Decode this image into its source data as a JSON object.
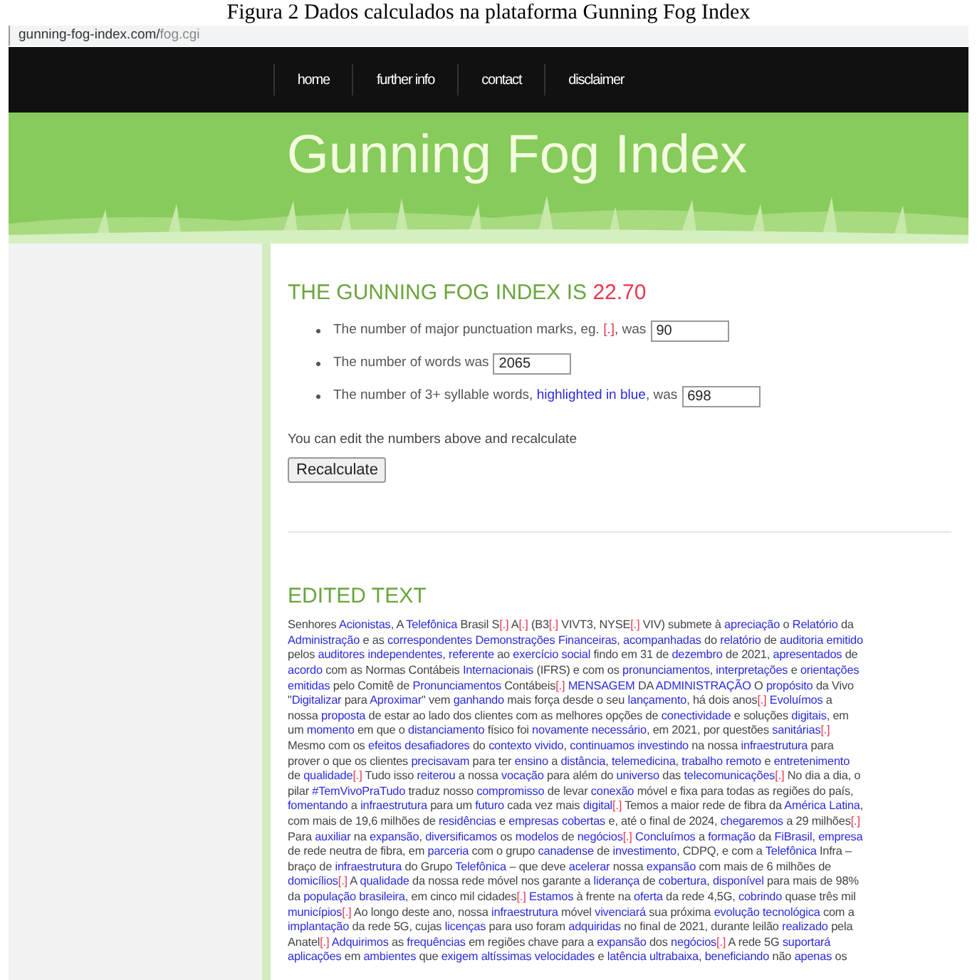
{
  "caption": "Figura 2 Dados calculados na plataforma Gunning Fog Index",
  "address_bar": {
    "host": "gunning-fog-index.com/",
    "path": "fog.cgi"
  },
  "nav": [
    {
      "label": "home"
    },
    {
      "label": "further info"
    },
    {
      "label": "contact"
    },
    {
      "label": "disclaimer"
    }
  ],
  "banner": {
    "title": "Gunning Fog Index"
  },
  "result": {
    "heading": "THE GUNNING FOG INDEX IS",
    "score": "22.70"
  },
  "measures": [
    {
      "text": "The number of major punctuation marks, eg. *[.]*, was",
      "value": "90"
    },
    {
      "text": "The number of words was",
      "value": "2065"
    },
    {
      "text": "The number of 3+ syllable words, **highlighted in blue**, was",
      "value": "698"
    }
  ],
  "note": "You can edit the numbers above and recalculate",
  "recalculate_button": "Recalculate",
  "edited_text": {
    "heading": "EDITED TEXT",
    "lines": [
      [
        {
          "kind": "text",
          "text": "Senhores **Acionistas**, A **Telefônica** Brasil S"
        },
        {
          "kind": "mark",
          "text": "[.]"
        },
        {
          "kind": "text",
          "text": " A"
        },
        {
          "kind": "mark",
          "text": "[.]"
        },
        {
          "kind": "text",
          "text": " (B3"
        },
        {
          "kind": "mark",
          "text": "[.]"
        },
        {
          "kind": "text",
          "text": " VIVT3, NYSE"
        },
        {
          "kind": "mark",
          "text": "[.]"
        },
        {
          "kind": "text",
          "text": " VIV) submete à **apreciação** o **Relatório** da"
        }
      ],
      [
        {
          "kind": "text",
          "text": "**Administração** e as **correspondentes** **Demonstrações** **Financeiras**, **acompanhadas** do **relatório** de **auditoria** **emitido**"
        }
      ],
      [
        {
          "kind": "text",
          "text": "pelos **auditores** **independentes**, **referente** ao **exercício** **social** findo em 31 de **dezembro** de 2021, **apresentados** de"
        }
      ],
      [
        {
          "kind": "text",
          "text": "**acordo** com as Normas Contábeis **Internacionais** (IFRS) e com os **pronunciamentos**, **interpretações** e **orientações**"
        }
      ],
      [
        {
          "kind": "text",
          "text": "**emitidas** pelo Comitê de **Pronunciamentos** Contábeis"
        },
        {
          "kind": "mark",
          "text": "[.]"
        },
        {
          "kind": "text",
          "text": " **MENSAGEM** DA **ADMINISTRAÇÃO** O **propósito** da Vivo"
        }
      ],
      [
        {
          "kind": "text",
          "text": "\"**Digitalizar** para **Aproximar**\" vem **ganhando** mais força desde o seu **lançamento**, há dois anos"
        },
        {
          "kind": "mark",
          "text": "[.]"
        },
        {
          "kind": "text",
          "text": " **Evoluímos** a"
        }
      ],
      [
        {
          "kind": "text",
          "text": "nossa **proposta** de estar ao lado dos clientes com as melhores opções de **conectividade** e soluções **digitais**, em"
        }
      ],
      [
        {
          "kind": "text",
          "text": "um **momento** em que o **distanciamento** físico foi **novamente** **necessário**, em 2021, por questões **sanitárias**"
        },
        {
          "kind": "mark",
          "text": "[.]"
        }
      ],
      [
        {
          "kind": "text",
          "text": "Mesmo com os **efeitos** **desafiadores** do **contexto** **vivido**, **continuamos** **investindo** na nossa **infraestrutura** para"
        }
      ],
      [
        {
          "kind": "text",
          "text": "prover o que os clientes **precisavam** para ter **ensino** a **distância**, **telemedicina**, **trabalho** **remoto** e **entretenimento**"
        }
      ],
      [
        {
          "kind": "text",
          "text": "de **qualidade**"
        },
        {
          "kind": "mark",
          "text": "[.]"
        },
        {
          "kind": "text",
          "text": " Tudo isso **reiterou** a nossa **vocação** para além do **universo** das **telecomunicações**"
        },
        {
          "kind": "mark",
          "text": "[.]"
        },
        {
          "kind": "text",
          "text": " No dia a dia, o"
        }
      ],
      [
        {
          "kind": "text",
          "text": "pilar **#TemVivoPraTudo** traduz nosso **compromisso** de levar **conexão** móvel e fixa para todas as regiões do país,"
        }
      ],
      [
        {
          "kind": "text",
          "text": "**fomentando** a **infraestrutura** para um **futuro** cada vez mais **digital**"
        },
        {
          "kind": "mark",
          "text": "[.]"
        },
        {
          "kind": "text",
          "text": " Temos a maior rede de fibra da **América** **Latina**,"
        }
      ],
      [
        {
          "kind": "text",
          "text": "com mais de 19,6 milhões de **residências** e **empresas** **cobertas** e, até o final de 2024, **chegaremos** a 29 milhões"
        },
        {
          "kind": "mark",
          "text": "[.]"
        }
      ],
      [
        {
          "kind": "text",
          "text": "Para **auxiliar** na **expansão**, **diversificamos** os **modelos** de **negócios**"
        },
        {
          "kind": "mark",
          "text": "[.]"
        },
        {
          "kind": "text",
          "text": " **Concluímos** a **formação** da **FiBrasil**, **empresa**"
        }
      ],
      [
        {
          "kind": "text",
          "text": "de rede neutra de fibra, em **parceria** com o grupo **canadense** de **investimento**, CDPQ, e com a **Telefônica** Infra –"
        }
      ],
      [
        {
          "kind": "text",
          "text": "braço de **infraestrutura** do Grupo **Telefônica** – que deve **acelerar** nossa **expansão** com mais de 6 milhões de"
        }
      ],
      [
        {
          "kind": "text",
          "text": "**domicílios**"
        },
        {
          "kind": "mark",
          "text": "[.]"
        },
        {
          "kind": "text",
          "text": " A **qualidade** da nossa rede móvel nos garante a **liderança** de **cobertura**, **disponível** para mais de 98%"
        }
      ],
      [
        {
          "kind": "text",
          "text": "da **população** **brasileira**, em cinco mil cidades"
        },
        {
          "kind": "mark",
          "text": "[.]"
        },
        {
          "kind": "text",
          "text": " **Estamos** à frente na **oferta** da rede 4,5G, **cobrindo** quase três mil"
        }
      ],
      [
        {
          "kind": "text",
          "text": "**municípios**"
        },
        {
          "kind": "mark",
          "text": "[.]"
        },
        {
          "kind": "text",
          "text": " Ao longo deste ano, nossa **infraestrutura** móvel **vivenciará** sua próxima **evolução** **tecnológica** com a"
        }
      ],
      [
        {
          "kind": "text",
          "text": "**implantação** da rede 5G, cujas **licenças** para uso foram **adquiridas** no final de 2021, durante leilão **realizado** pela"
        }
      ],
      [
        {
          "kind": "text",
          "text": "Anatel"
        },
        {
          "kind": "mark",
          "text": "[.]"
        },
        {
          "kind": "text",
          "text": " **Adquirimos** as **frequências** em regiões chave para a **expansão** dos **negócios**"
        },
        {
          "kind": "mark",
          "text": "[.]"
        },
        {
          "kind": "text",
          "text": " A rede 5G **suportará**"
        }
      ],
      [
        {
          "kind": "text",
          "text": "**aplicações** em **ambientes** que **exigem** **altíssimas** **velocidades** e **latência** **ultrabaixa**, **beneficiando** não **apenas** os"
        }
      ]
    ]
  }
}
